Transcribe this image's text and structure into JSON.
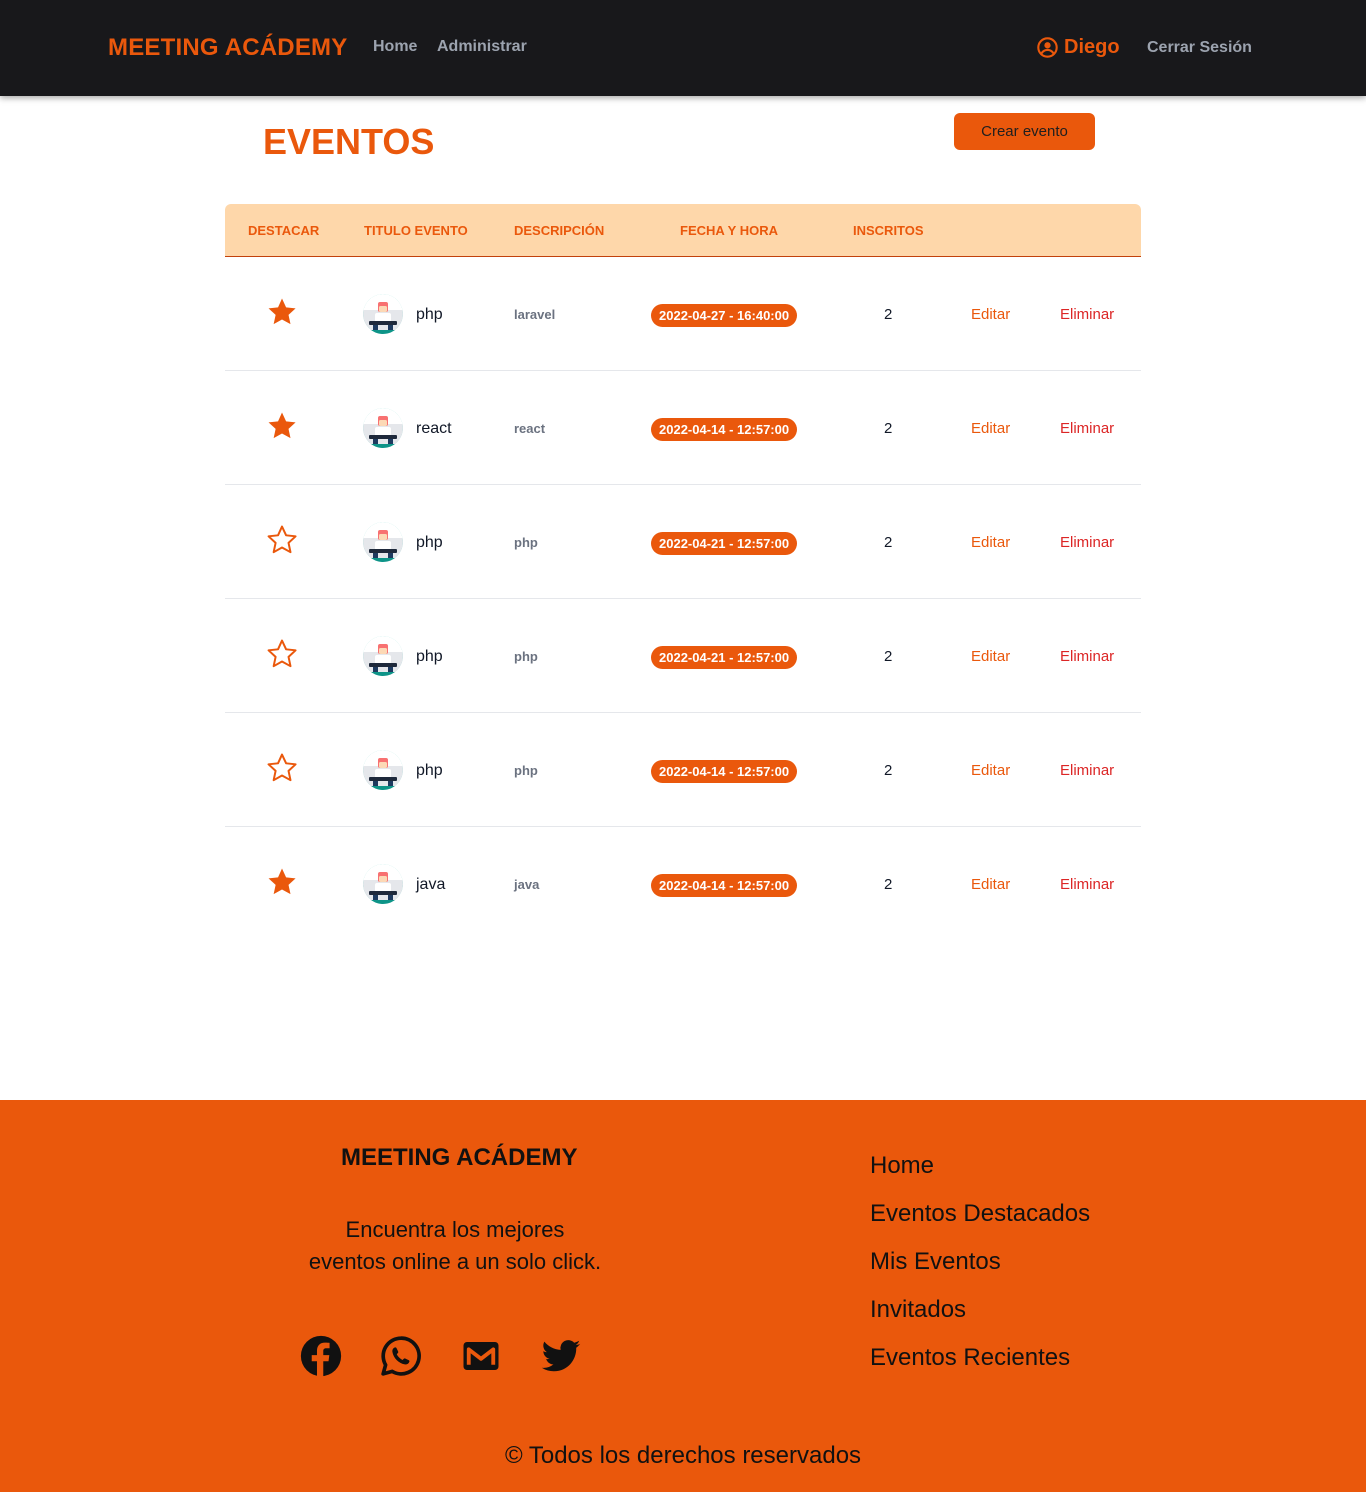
{
  "navbar": {
    "brand": "MEETING ACÁDEMY",
    "links": [
      {
        "label": "Home"
      },
      {
        "label": "Administrar"
      }
    ],
    "user_name": "Diego",
    "logout_label": "Cerrar Sesión",
    "icons": {
      "user": "user-circle-icon"
    }
  },
  "page": {
    "title": "EVENTOS",
    "create_button": "Crear evento"
  },
  "table": {
    "headers": {
      "destacar": "DESTACAR",
      "titulo": "TITULO EVENTO",
      "descripcion": "DESCRIPCIÓN",
      "fecha": "FECHA Y HORA",
      "inscritos": "INSCRITOS"
    },
    "rows": [
      {
        "featured": true,
        "title": "php",
        "description": "laravel",
        "datetime": "2022-04-27 - 16:40:00",
        "enrolled": "2",
        "edit_label": "Editar",
        "delete_label": "Eliminar"
      },
      {
        "featured": true,
        "title": "react",
        "description": "react",
        "datetime": "2022-04-14 - 12:57:00",
        "enrolled": "2",
        "edit_label": "Editar",
        "delete_label": "Eliminar"
      },
      {
        "featured": false,
        "title": "php",
        "description": "php",
        "datetime": "2022-04-21 - 12:57:00",
        "enrolled": "2",
        "edit_label": "Editar",
        "delete_label": "Eliminar"
      },
      {
        "featured": false,
        "title": "php",
        "description": "php",
        "datetime": "2022-04-21 - 12:57:00",
        "enrolled": "2",
        "edit_label": "Editar",
        "delete_label": "Eliminar"
      },
      {
        "featured": false,
        "title": "php",
        "description": "php",
        "datetime": "2022-04-14 - 12:57:00",
        "enrolled": "2",
        "edit_label": "Editar",
        "delete_label": "Eliminar"
      },
      {
        "featured": true,
        "title": "java",
        "description": "java",
        "datetime": "2022-04-14 - 12:57:00",
        "enrolled": "2",
        "edit_label": "Editar",
        "delete_label": "Eliminar"
      }
    ]
  },
  "footer": {
    "brand": "MEETING ACÁDEMY",
    "tagline": [
      "Encuentra los mejores",
      "eventos online a un solo click."
    ],
    "socials": [
      "facebook-icon",
      "whatsapp-icon",
      "gmail-icon",
      "twitter-icon"
    ],
    "links": [
      "Home",
      "Eventos Destacados",
      "Mis Eventos",
      "Invitados",
      "Eventos Recientes"
    ],
    "copyright": "© Todos los derechos reservados"
  },
  "colors": {
    "accent": "#ea580c",
    "navbar_bg": "#18181b",
    "table_header_bg": "#fed7aa",
    "delete": "#dc2626",
    "muted": "#9ca3af"
  }
}
